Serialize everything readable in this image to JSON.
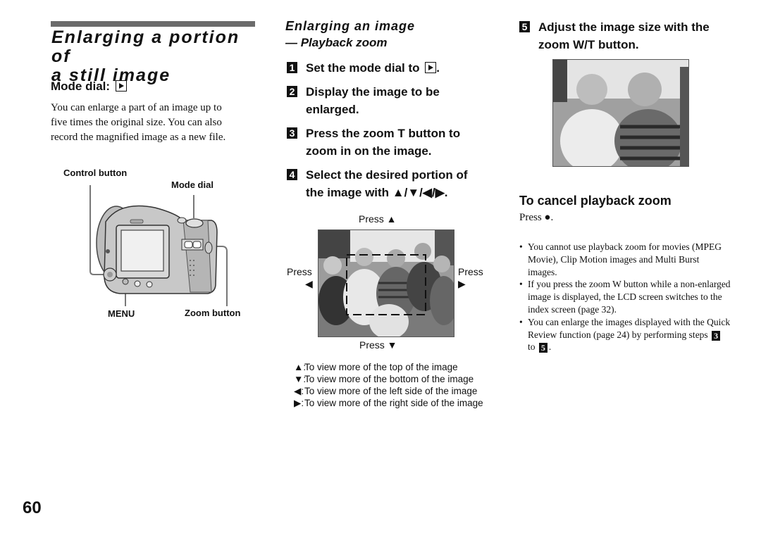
{
  "page_number": "60",
  "left": {
    "title_line1": "Enlarging a portion of",
    "title_line2": "a still image",
    "mode_dial_label": "Mode dial:",
    "intro_text": [
      "You can enlarge a part of an image up to",
      "five times the original size. You can also",
      "record the magnified image as a new file."
    ],
    "figure_labels": {
      "control_button": "Control button",
      "mode_dial": "Mode dial",
      "menu": "MENU",
      "zoom_button": "Zoom button"
    }
  },
  "middle": {
    "section_title": "Enlarging an image",
    "section_subtitle": "— Playback zoom",
    "steps": [
      {
        "num": "1",
        "line1": "Set the mode dial to",
        "line2": ""
      },
      {
        "num": "2",
        "line1": "Display the image to be",
        "line2": "enlarged."
      },
      {
        "num": "3",
        "line1": "Press the zoom T button to",
        "line2": "zoom in on the image."
      },
      {
        "num": "4",
        "line1": "Select the desired portion of",
        "line2": "the image with ▲/▼/◀/▶."
      }
    ],
    "press_up": "Press ▲",
    "press_down": "Press ▼",
    "press_left": "Press",
    "press_left_arrow": "◀",
    "press_right": "Press",
    "press_right_arrow": "▶",
    "legend": [
      {
        "symbol": "▲:",
        "text": "To view more of the top of the image"
      },
      {
        "symbol": "▼:",
        "text": "To view more of the bottom of the image"
      },
      {
        "symbol": "◀:",
        "text": "To view more of the left side of the image"
      },
      {
        "symbol": "▶:",
        "text": "To view more of the right side of the image"
      }
    ]
  },
  "right": {
    "step5_num": "5",
    "step5_line1": "Adjust the image size with the",
    "step5_line2": "zoom W/T button.",
    "cancel_title": "To cancel playback zoom",
    "cancel_text": "Press ●.",
    "notes": [
      "You cannot use playback zoom for movies (MPEG Movie), Clip Motion images and Multi Burst images.",
      "If you press the zoom W button while a non-enlarged image is displayed, the LCD screen switches to the index screen (page 32).",
      "You can enlarge the images displayed with the Quick Review function (page 24) by"
    ],
    "note3_tail_prefix": "performing steps",
    "note3_step_from": "3",
    "note3_to": "to",
    "note3_step_to": "5",
    "note3_end": "."
  }
}
